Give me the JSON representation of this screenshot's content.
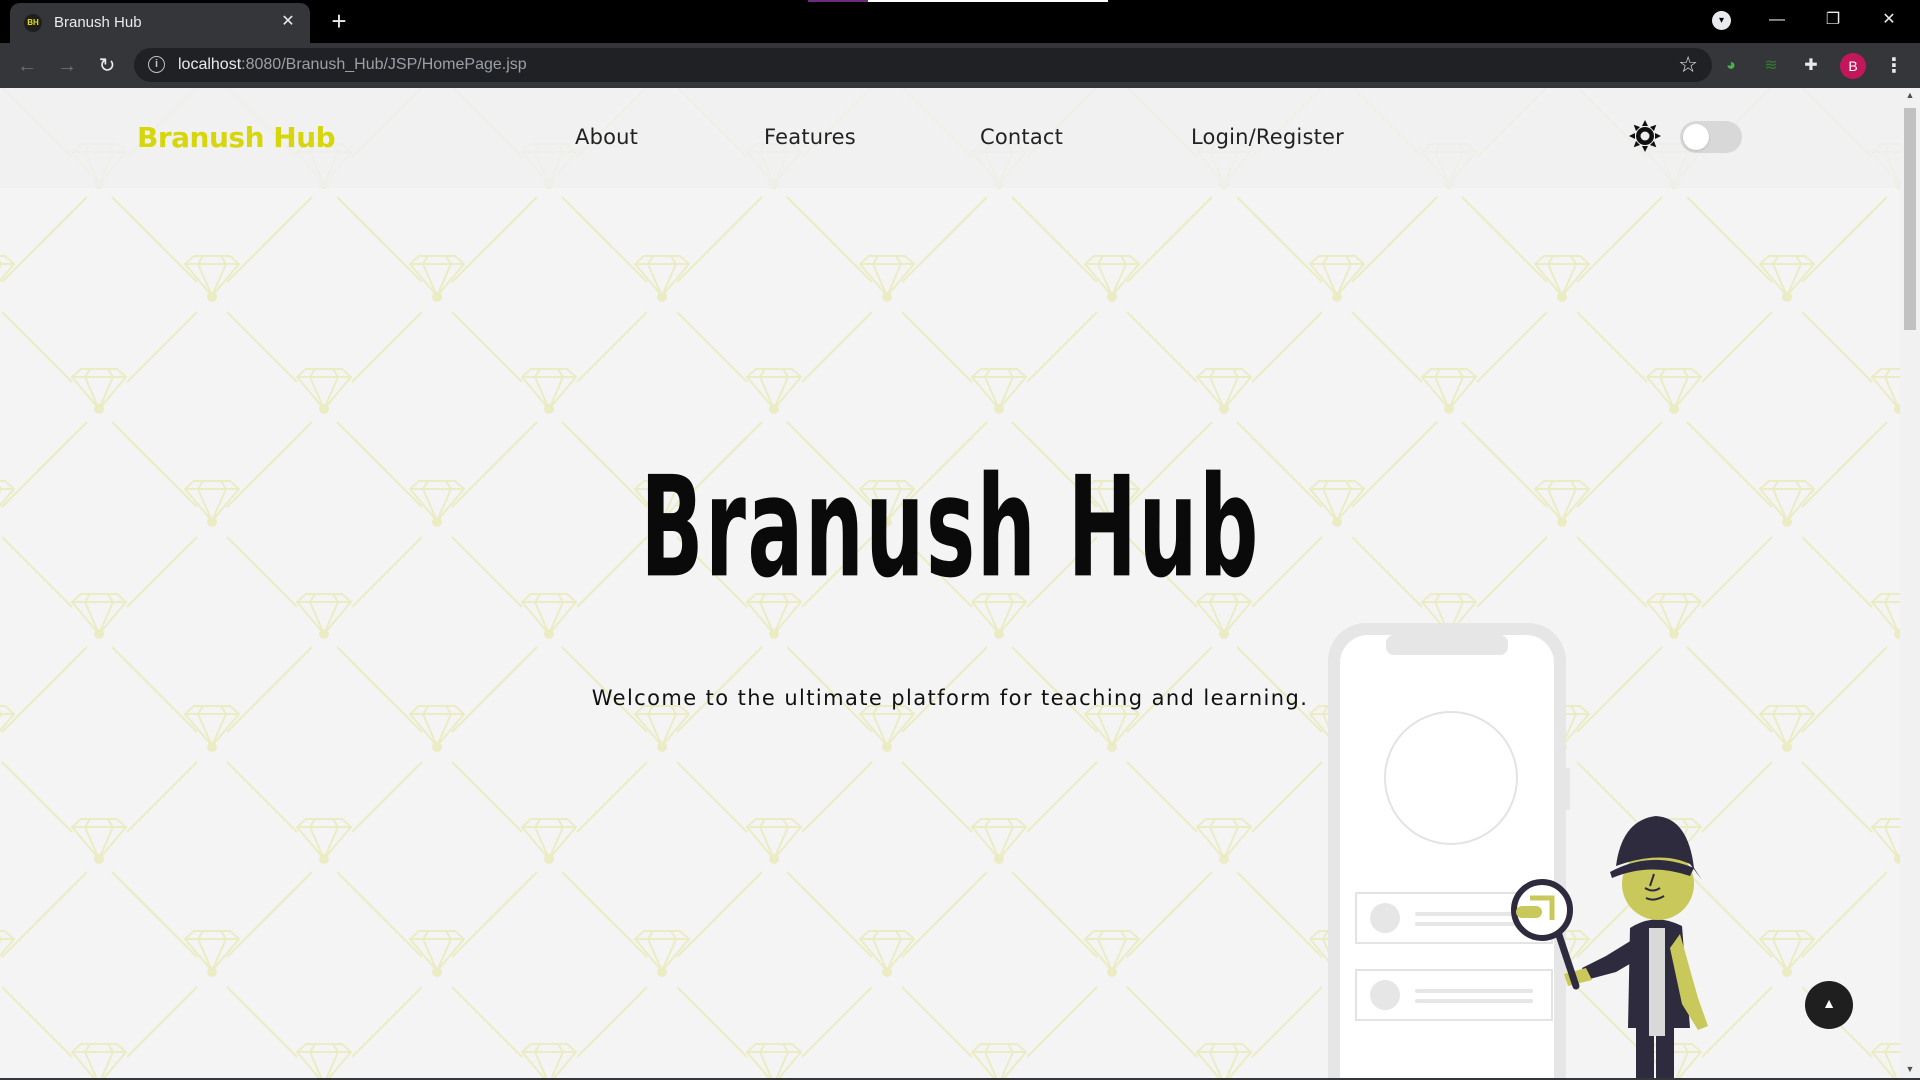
{
  "browser": {
    "tab_title": "Branush Hub",
    "tab_favicon_text": "BH",
    "tab_close": "✕",
    "new_tab": "+",
    "url_host": "localhost",
    "url_path": ":8080/Branush_Hub/JSP/HomePage.jsp",
    "avatar_letter": "B",
    "icons": [
      "back-icon",
      "forward-icon",
      "reload-icon",
      "info-icon",
      "star-icon",
      "extensions-icon",
      "menu-icon",
      "minimize-icon",
      "restore-icon",
      "close-icon"
    ]
  },
  "navbar": {
    "logo": "Branush Hub",
    "links": [
      "About",
      "Features",
      "Contact",
      "Login/Register"
    ],
    "theme_icon": "sun-icon",
    "dark_mode_toggle": false
  },
  "hero": {
    "title": "Branush Hub",
    "tagline": "Welcome to the ultimate platform for teaching and learning."
  },
  "colors": {
    "brand": "#d6d60a",
    "background": "#f4f4f4",
    "pattern": "#ecedc7",
    "text": "#0a0a0a",
    "illustration_skin": "#c9c85a",
    "illustration_dark": "#2d2b3d"
  },
  "scroll_to_top_icon": "arrow-up-icon"
}
